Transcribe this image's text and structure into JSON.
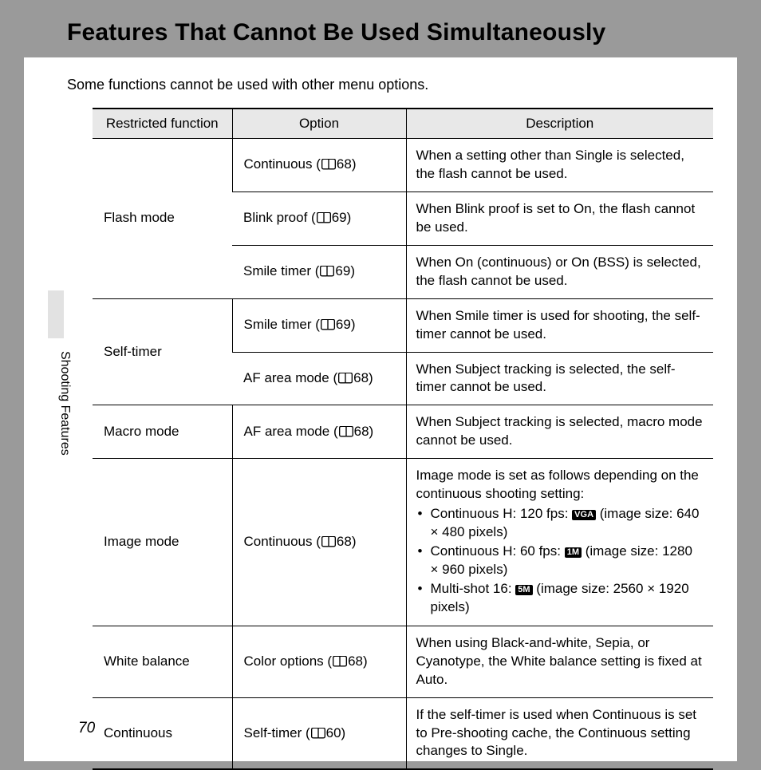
{
  "title": "Features That Cannot Be Used Simultaneously",
  "intro": "Some functions cannot be used with other menu options.",
  "side_label": "Shooting Features",
  "page_number": "70",
  "headers": {
    "restricted": "Restricted function",
    "option": "Option",
    "description": "Description"
  },
  "rows": {
    "flash": {
      "restricted": "Flash mode",
      "opt1": {
        "name": "Continuous",
        "ref": "68"
      },
      "desc1": {
        "pre": "When a setting other than ",
        "b1": "Single",
        "post": " is selected, the flash cannot be used."
      },
      "opt2": {
        "name": "Blink proof",
        "ref": "69"
      },
      "desc2": {
        "pre": "When ",
        "b1": "Blink proof",
        "mid": " is set to ",
        "b2": "On",
        "post": ", the flash cannot be used."
      },
      "opt3": {
        "name": "Smile timer",
        "ref": "69"
      },
      "desc3": {
        "pre": "When ",
        "b1": "On (continuous)",
        "mid": " or ",
        "b2": "On (BSS)",
        "post": " is selected, the flash cannot be used."
      }
    },
    "selftimer": {
      "restricted": "Self-timer",
      "opt1": {
        "name": "Smile timer",
        "ref": "69"
      },
      "desc1": {
        "pre": "When ",
        "b1": "Smile timer",
        "post": " is used for shooting, the self-timer cannot be used."
      },
      "opt2": {
        "name": "AF area mode",
        "ref": "68"
      },
      "desc2": {
        "pre": "When ",
        "b1": "Subject tracking",
        "post": " is selected, the self-timer cannot be used."
      }
    },
    "macro": {
      "restricted": "Macro mode",
      "opt1": {
        "name": "AF area mode",
        "ref": "68"
      },
      "desc1": {
        "pre": "When ",
        "b1": "Subject tracking",
        "post": " is selected, macro mode cannot be used."
      }
    },
    "image": {
      "restricted": "Image mode",
      "opt1": {
        "name": "Continuous",
        "ref": "68"
      },
      "desc1": {
        "intro_b": "Image mode",
        "intro_post": " is set as follows depending on the continuous shooting setting:",
        "li1": {
          "b": "Continuous H: 120 fps",
          "sep": ": ",
          "badge": "VGA",
          "post": " (image size: 640 × 480 pixels)"
        },
        "li2": {
          "b": "Continuous H: 60 fps",
          "sep": ": ",
          "badge": "1M",
          "post": " (image size: 1280 × 960 pixels)"
        },
        "li3": {
          "b": "Multi-shot 16",
          "sep": ": ",
          "badge": "5M",
          "post": " (image size: 2560 × 1920 pixels)"
        }
      }
    },
    "white": {
      "restricted": "White balance",
      "opt1": {
        "name": "Color options",
        "ref": "68"
      },
      "desc1": {
        "pre": "When using ",
        "b1": "Black-and-white",
        "mid1": ", ",
        "b2": "Sepia",
        "mid2": ", or ",
        "b3": "Cyanotype",
        "mid3": ", the ",
        "b4": "White balance",
        "mid4": " setting is fixed at ",
        "b5": "Auto",
        "post": "."
      }
    },
    "cont": {
      "restricted": "Continuous",
      "opt1": {
        "name": "Self-timer",
        "ref": "60"
      },
      "desc1": {
        "pre": "If the self-timer is used when ",
        "b1": "Continuous",
        "mid1": " is set to ",
        "b2": "Pre-shooting cache",
        "mid2": ", the ",
        "b3": "Continuous",
        "mid3": " setting changes to ",
        "b4": "Single",
        "post": "."
      }
    }
  }
}
